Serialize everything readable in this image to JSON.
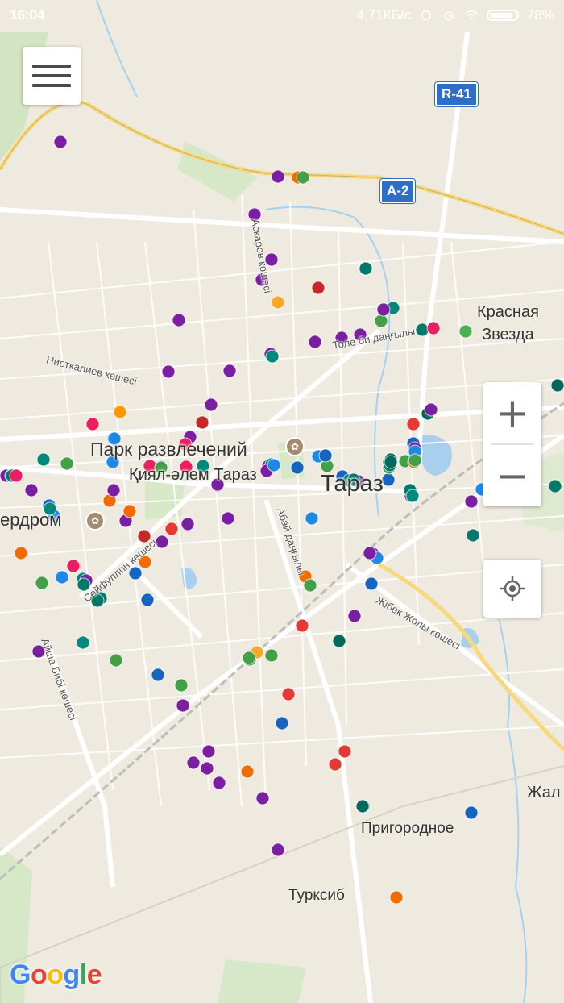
{
  "status_bar": {
    "time": "16:04",
    "network_speed": "4,71КБ/с",
    "battery": "78%"
  },
  "map": {
    "route_shields": [
      "R-41",
      "A-2"
    ],
    "place_labels": [
      "Парк развлечений",
      "Қиял-әлем Тараз",
      "Тараз",
      "Красная",
      "Звезда",
      "ердром",
      "Пригородное",
      "Турксиб",
      "Жал"
    ],
    "street_labels": [
      "Ниеткалиев көшесі",
      "Абай даңғылы",
      "Сейфуллин көшесі",
      "Жібек Жолы көшесі",
      "Айша Бибі көшесі",
      "Толе би даңғылы",
      "Аскаров көшесі"
    ],
    "markers": [
      {
        "c": "#d5a6e6"
      },
      {
        "c": "#7b1fa2"
      },
      {
        "c": "#7b1fa2"
      },
      {
        "c": "#ef6c00"
      },
      {
        "c": "#43a047"
      },
      {
        "c": "#7b1fa2"
      },
      {
        "c": "#7b1fa2"
      },
      {
        "c": "#7b1fa2"
      },
      {
        "c": "#f9a825"
      },
      {
        "c": "#c62828"
      },
      {
        "c": "#00796b"
      },
      {
        "c": "#7b1fa2"
      },
      {
        "c": "#7b1fa2"
      },
      {
        "c": "#00897b"
      },
      {
        "c": "#43a047"
      },
      {
        "c": "#00796b"
      },
      {
        "c": "#e91e63"
      },
      {
        "c": "#4caf50"
      },
      {
        "c": "#00695c"
      },
      {
        "c": "#7b1fa2"
      },
      {
        "c": "#7b1fa2"
      },
      {
        "c": "#7b1fa2"
      },
      {
        "c": "#7b1fa2"
      },
      {
        "c": "#7b1fa2"
      },
      {
        "c": "#7b1fa2"
      },
      {
        "c": "#7b1fa2"
      },
      {
        "c": "#e91e63"
      },
      {
        "c": "#ff9800"
      },
      {
        "c": "#c62828"
      },
      {
        "c": "#7b1fa2"
      },
      {
        "c": "#1e88e5"
      },
      {
        "c": "#e91e63"
      },
      {
        "c": "#00796b"
      },
      {
        "c": "#e91e63"
      },
      {
        "c": "#1e88e5"
      },
      {
        "c": "#43a047"
      },
      {
        "c": "#1565c0"
      },
      {
        "c": "#1e88e5"
      },
      {
        "c": "#00796b"
      },
      {
        "c": "#7b1fa2"
      },
      {
        "c": "#00897b"
      },
      {
        "c": "#00897b"
      },
      {
        "c": "#43a047"
      },
      {
        "c": "#ef6c00"
      },
      {
        "c": "#1565c0"
      },
      {
        "c": "#1e88e5"
      },
      {
        "c": "#00897b"
      },
      {
        "c": "#7b1fa2"
      },
      {
        "c": "#7b1fa2"
      },
      {
        "c": "#ef6c00"
      },
      {
        "c": "#7b1fa2"
      },
      {
        "c": "#7b1fa2"
      },
      {
        "c": "#1e88e5"
      },
      {
        "c": "#7b1fa2"
      },
      {
        "c": "#e91e63"
      },
      {
        "c": "#ef6c00"
      },
      {
        "c": "#7b1fa2"
      },
      {
        "c": "#43a047"
      },
      {
        "c": "#00796b"
      },
      {
        "c": "#e53935"
      },
      {
        "c": "#1e88e5"
      },
      {
        "c": "#ef6c00"
      },
      {
        "c": "#c62828"
      },
      {
        "c": "#00897b"
      },
      {
        "c": "#e91e63"
      },
      {
        "c": "#7b1fa2"
      },
      {
        "c": "#1565c0"
      },
      {
        "c": "#1e88e5"
      },
      {
        "c": "#00796b"
      },
      {
        "c": "#7b1fa2"
      },
      {
        "c": "#43a047"
      },
      {
        "c": "#1565c0"
      },
      {
        "c": "#00897b"
      },
      {
        "c": "#7b1fa2"
      },
      {
        "c": "#00695c"
      },
      {
        "c": "#1565c0"
      },
      {
        "c": "#43a047"
      },
      {
        "c": "#1565c0"
      },
      {
        "c": "#43a047"
      },
      {
        "c": "#7b1fa2"
      },
      {
        "c": "#7b1fa2"
      },
      {
        "c": "#7b1fa2"
      },
      {
        "c": "#7b1fa2"
      },
      {
        "c": "#7b1fa2"
      },
      {
        "c": "#ef6c00"
      },
      {
        "c": "#7b1fa2"
      },
      {
        "c": "#7b1fa2"
      },
      {
        "c": "#43a047"
      },
      {
        "c": "#f9a825"
      },
      {
        "c": "#43a047"
      },
      {
        "c": "#e53935"
      },
      {
        "c": "#1565c0"
      },
      {
        "c": "#e53935"
      },
      {
        "c": "#e53935"
      },
      {
        "c": "#00695c"
      },
      {
        "c": "#1565c0"
      },
      {
        "c": "#ef6c00"
      },
      {
        "c": "#7b1fa2"
      },
      {
        "c": "#1e88e5"
      },
      {
        "c": "#1e88e5"
      },
      {
        "c": "#00796b"
      },
      {
        "c": "#7b1fa2"
      },
      {
        "c": "#e53935"
      },
      {
        "c": "#43a047"
      },
      {
        "c": "#ef6c00"
      },
      {
        "c": "#e53935"
      },
      {
        "c": "#00695c"
      },
      {
        "c": "#7b1fa2"
      },
      {
        "c": "#1565c0"
      },
      {
        "c": "#00796b"
      },
      {
        "c": "#7b1fa2"
      },
      {
        "c": "#1e88e5"
      },
      {
        "c": "#43a047"
      },
      {
        "c": "#1565c0"
      },
      {
        "c": "#43a047"
      },
      {
        "c": "#00897b"
      },
      {
        "c": "#00897b"
      },
      {
        "c": "#00897b"
      },
      {
        "c": "#00796b"
      },
      {
        "c": "#1565c0"
      },
      {
        "c": "#7b1fa2"
      },
      {
        "c": "#7b1fa2"
      },
      {
        "c": "#ef6c00"
      },
      {
        "c": "#00897b"
      },
      {
        "c": "#00796b"
      },
      {
        "c": "#00796b"
      },
      {
        "c": "#7b1fa2"
      },
      {
        "c": "#7b1fa2"
      },
      {
        "c": "#00897b"
      },
      {
        "c": "#7b1fa2"
      },
      {
        "c": "#43a047"
      },
      {
        "c": "#e91e63"
      },
      {
        "c": "#00796b"
      },
      {
        "c": "#7b1fa2"
      },
      {
        "c": "#00796b"
      },
      {
        "c": "#43a047"
      },
      {
        "c": "#00796b"
      },
      {
        "c": "#00796b"
      },
      {
        "c": "#1e88e5"
      },
      {
        "c": "#1565c0"
      },
      {
        "c": "#00796b"
      },
      {
        "c": "#00695c"
      },
      {
        "c": "#1e88e5"
      },
      {
        "c": "#00695c"
      },
      {
        "c": "#7b1fa2"
      },
      {
        "c": "#7b1fa2"
      },
      {
        "c": "#00897b"
      },
      {
        "c": "#e91e63"
      },
      {
        "c": "#00695c"
      },
      {
        "c": "#1e88e5"
      }
    ]
  },
  "controls": {
    "menu_icon": "hamburger-icon",
    "zoom_in_label": "+",
    "zoom_out_label": "−",
    "locate_icon": "my-location-icon"
  },
  "attribution": {
    "logo_text": [
      "G",
      "o",
      "o",
      "g",
      "l",
      "e"
    ],
    "logo_colors": [
      "#4285f4",
      "#ea4335",
      "#fbbc05",
      "#4285f4",
      "#34a853",
      "#ea4335"
    ]
  }
}
